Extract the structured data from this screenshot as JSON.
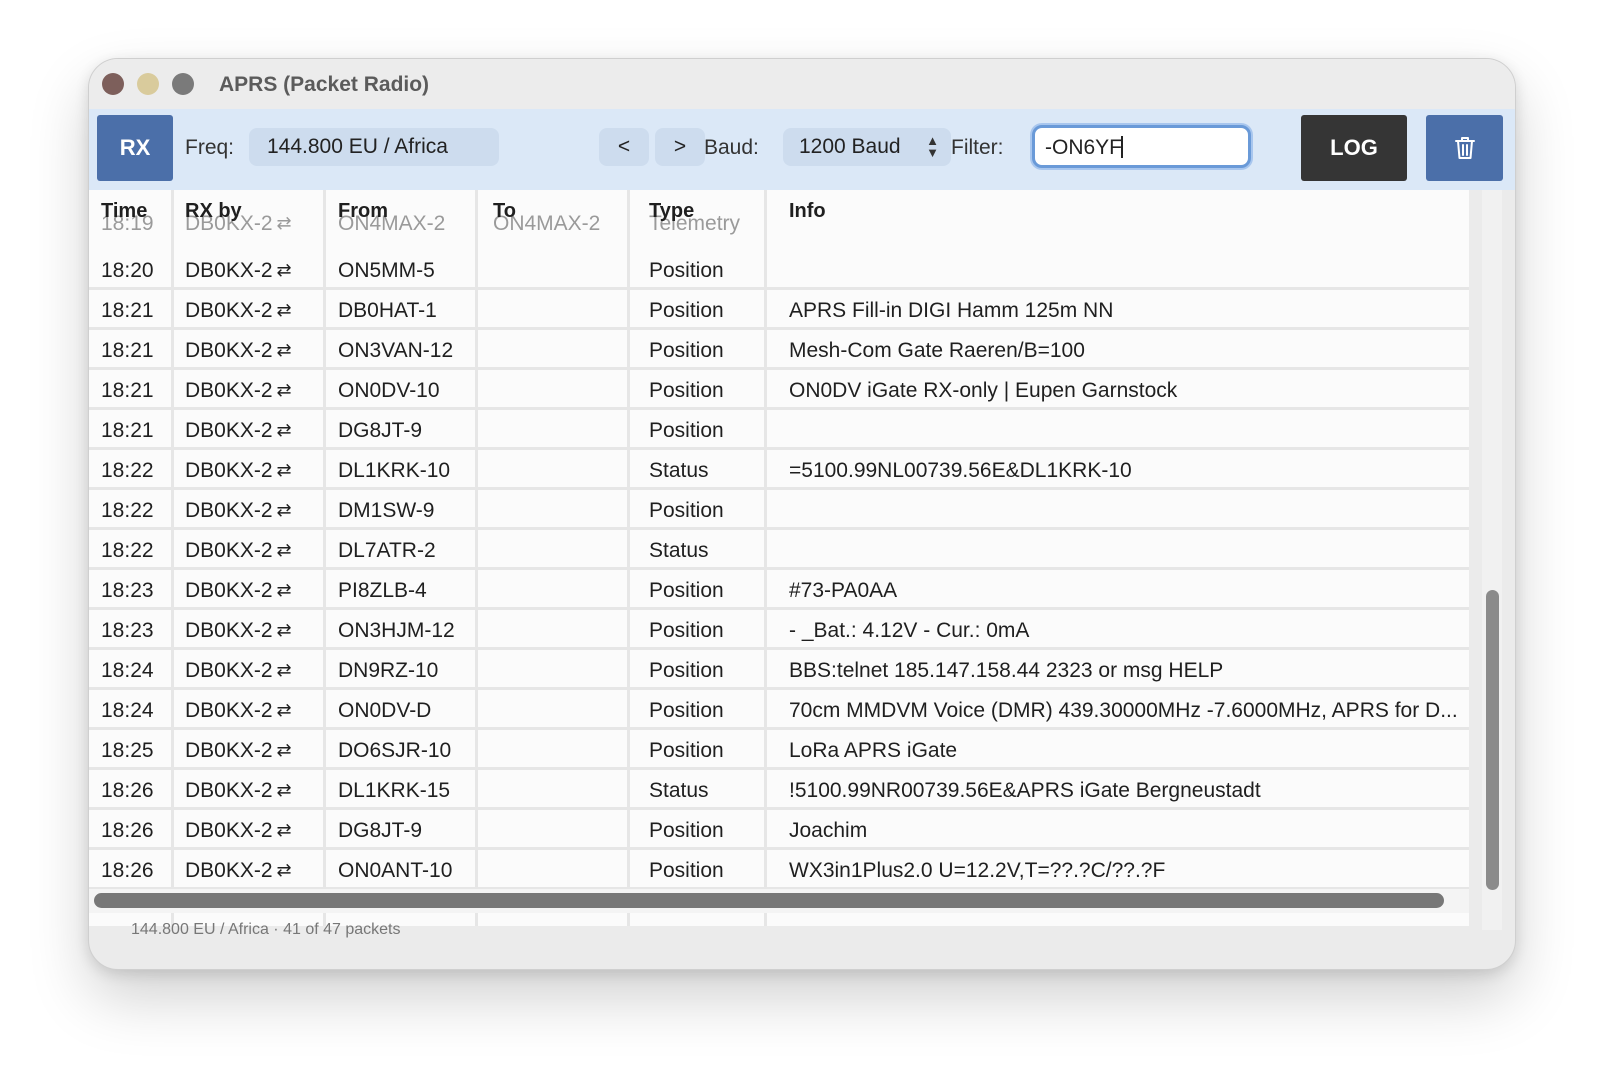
{
  "window": {
    "title": "APRS (Packet Radio)"
  },
  "toolbar": {
    "rx_label": "RX",
    "freq_label": "Freq:",
    "freq_value": "144.800 EU / Africa",
    "prev_label": "<",
    "next_label": ">",
    "baud_label": "Baud:",
    "baud_value": "1200 Baud",
    "filter_label": "Filter:",
    "filter_value": "-ON6YF",
    "log_label": "LOG",
    "trash_icon": "trash-icon",
    "map_icon": "map-icon"
  },
  "table": {
    "headers": {
      "time": "Time",
      "rx_by": "RX by",
      "from": "From",
      "to": "To",
      "type": "Type",
      "info": "Info"
    },
    "ghost_row": {
      "time": "18:19",
      "rx_by": "DB0KX-2",
      "from": "ON4MAX-2",
      "to": "ON4MAX-2",
      "type": "Telemetry",
      "info": ""
    },
    "rows": [
      {
        "time": "18:20",
        "rx_by": "DB0KX-2",
        "from": "ON5MM-5",
        "to": "",
        "type": "Position",
        "info": ""
      },
      {
        "time": "18:21",
        "rx_by": "DB0KX-2",
        "from": "DB0HAT-1",
        "to": "",
        "type": "Position",
        "info": " APRS Fill-in DIGI Hamm 125m NN"
      },
      {
        "time": "18:21",
        "rx_by": "DB0KX-2",
        "from": "ON3VAN-12",
        "to": "",
        "type": "Position",
        "info": "Mesh-Com Gate Raeren/B=100"
      },
      {
        "time": "18:21",
        "rx_by": "DB0KX-2",
        "from": "ON0DV-10",
        "to": "",
        "type": "Position",
        "info": "ON0DV iGate RX-only | Eupen Garnstock"
      },
      {
        "time": "18:21",
        "rx_by": "DB0KX-2",
        "from": "DG8JT-9",
        "to": "",
        "type": "Position",
        "info": ""
      },
      {
        "time": "18:22",
        "rx_by": "DB0KX-2",
        "from": "DL1KRK-10",
        "to": "",
        "type": "Status",
        "info": "=5100.99NL00739.56E&DL1KRK-10"
      },
      {
        "time": "18:22",
        "rx_by": "DB0KX-2",
        "from": "DM1SW-9",
        "to": "",
        "type": "Position",
        "info": ""
      },
      {
        "time": "18:22",
        "rx_by": "DB0KX-2",
        "from": "DL7ATR-2",
        "to": "",
        "type": "Status",
        "info": ""
      },
      {
        "time": "18:23",
        "rx_by": "DB0KX-2",
        "from": "PI8ZLB-4",
        "to": "",
        "type": "Position",
        "info": "#73-PA0AA"
      },
      {
        "time": "18:23",
        "rx_by": "DB0KX-2",
        "from": "ON3HJM-12",
        "to": "",
        "type": "Position",
        "info": " -  _Bat.: 4.12V - Cur.:  0mA"
      },
      {
        "time": "18:24",
        "rx_by": "DB0KX-2",
        "from": "DN9RZ-10",
        "to": "",
        "type": "Position",
        "info": "BBS:telnet 185.147.158.44 2323 or msg HELP"
      },
      {
        "time": "18:24",
        "rx_by": "DB0KX-2",
        "from": "ON0DV-D",
        "to": "",
        "type": "Position",
        "info": "70cm MMDVM Voice (DMR) 439.30000MHz -7.6000MHz, APRS for D..."
      },
      {
        "time": "18:25",
        "rx_by": "DB0KX-2",
        "from": "DO6SJR-10",
        "to": "",
        "type": "Position",
        "info": "LoRa APRS iGate"
      },
      {
        "time": "18:26",
        "rx_by": "DB0KX-2",
        "from": "DL1KRK-15",
        "to": "",
        "type": "Status",
        "info": "!5100.99NR00739.56E&APRS iGate Bergneustadt"
      },
      {
        "time": "18:26",
        "rx_by": "DB0KX-2",
        "from": "DG8JT-9",
        "to": "",
        "type": "Position",
        "info": " Joachim"
      },
      {
        "time": "18:26",
        "rx_by": "DB0KX-2",
        "from": "ON0ANT-10",
        "to": "",
        "type": "Position",
        "info": "WX3in1Plus2.0 U=12.2V,T=??.?C/??.?F"
      }
    ]
  },
  "status": {
    "text": "144.800 EU / Africa · 41 of 47 packets"
  },
  "icons": {
    "relay": "retweet-icon"
  }
}
